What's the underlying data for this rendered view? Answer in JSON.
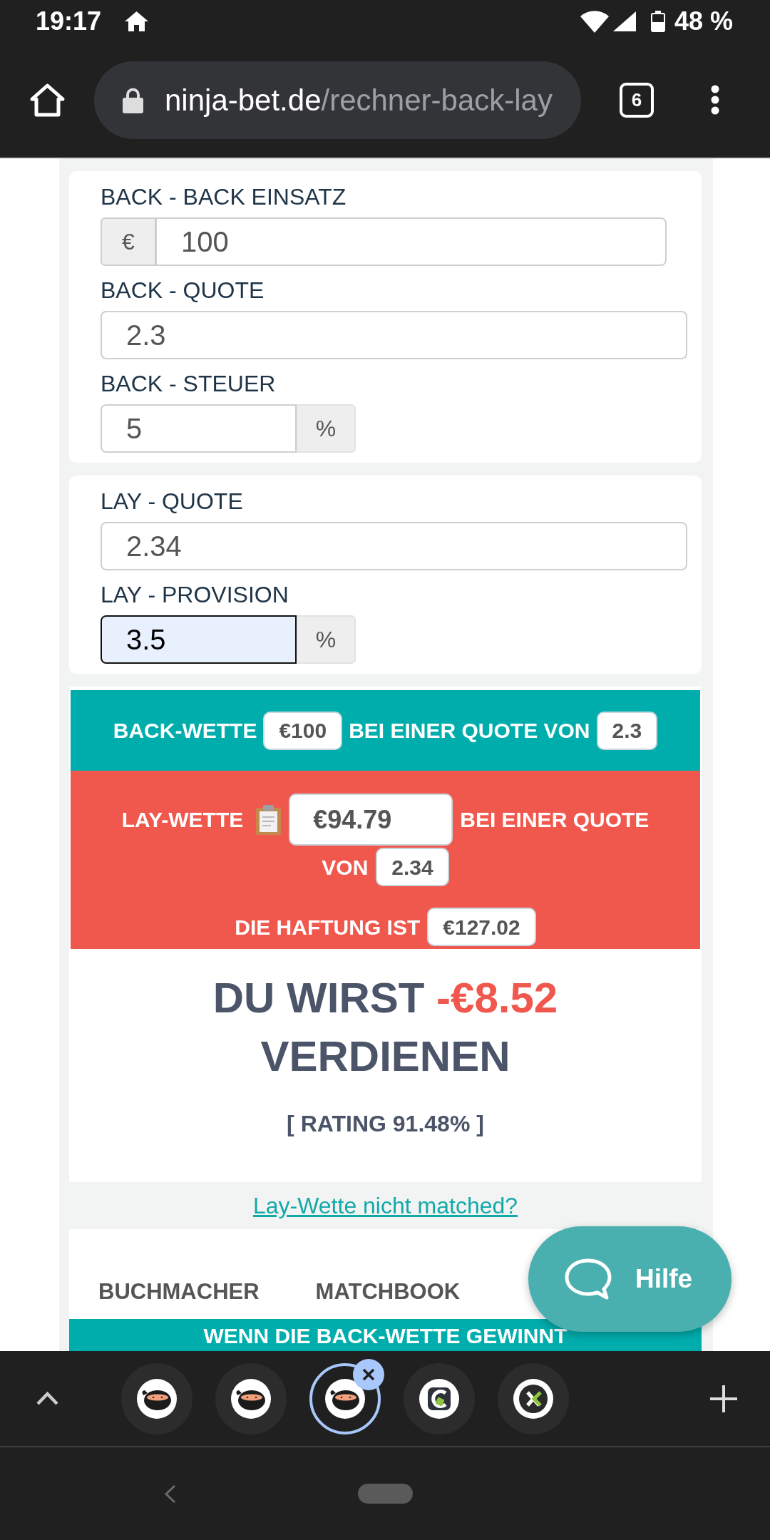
{
  "status_bar": {
    "time": "19:17",
    "battery": "48 %"
  },
  "toolbar": {
    "url_host": "ninja-bet.de",
    "url_path": "/rechner-back-lay",
    "tab_count": "6"
  },
  "back_panel": {
    "fields": [
      {
        "kind": "prefix",
        "label": "BACK - BACK EINSATZ",
        "addon": "€",
        "value": "100",
        "focused": false
      },
      {
        "kind": "plain",
        "label": "BACK - QUOTE",
        "value": "2.3",
        "focused": false
      },
      {
        "kind": "suffix",
        "label": "BACK - STEUER",
        "value": "5",
        "addon": "%",
        "focused": false
      }
    ]
  },
  "lay_panel": {
    "fields": [
      {
        "kind": "plain",
        "label": "LAY - QUOTE",
        "value": "2.34",
        "focused": false
      },
      {
        "kind": "suffix",
        "label": "LAY - PROVISION",
        "value": "3.5",
        "addon": "%",
        "focused": true
      }
    ]
  },
  "back_bet": {
    "title": "BACK-WETTE",
    "stake": "€100",
    "odds_text": "BEI EINER QUOTE VON",
    "odds": "2.3"
  },
  "lay_bet": {
    "title": "LAY-WETTE",
    "stake": "€94.79",
    "odds_text": "BEI EINER QUOTE",
    "odds_text_end": "VON",
    "odds": "2.34",
    "liability_text": "DIE HAFTUNG IST",
    "liability": "€127.02"
  },
  "result": {
    "prefix": "DU WIRST",
    "amount": "-€8.52",
    "suffix": "VERDIENEN",
    "rating": "[ RATING 91.48% ]"
  },
  "unmatched_link": "Lay-Wette nicht matched?",
  "bookmaker_section": {
    "tabs": [
      {
        "label": "BUCHMACHER"
      },
      {
        "label": "MATCHBOOK"
      }
    ],
    "heading": "WENN DIE BACK-WETTE GEWINNT"
  },
  "help_button": {
    "label": "Hilfe"
  },
  "tab_strip": {
    "tabs": [
      {
        "kind": "ninja",
        "selected": false
      },
      {
        "kind": "ninja",
        "selected": false
      },
      {
        "kind": "ninja",
        "selected": true
      },
      {
        "kind": "c-logo",
        "selected": false
      },
      {
        "kind": "x-logo",
        "selected": false
      }
    ]
  }
}
